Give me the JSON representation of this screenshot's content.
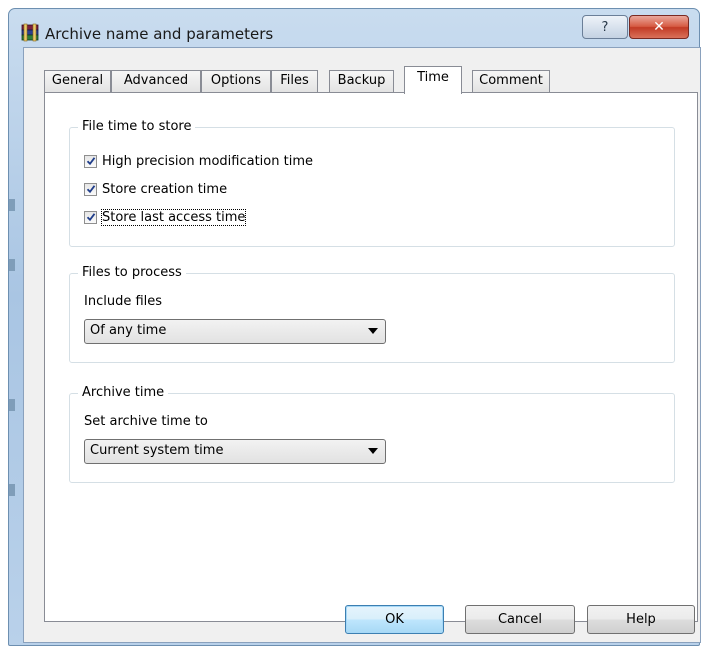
{
  "window": {
    "title": "Archive name and parameters",
    "help_glyph": "?",
    "close_glyph": "✕"
  },
  "tabs": [
    {
      "label": "General",
      "selected": false
    },
    {
      "label": "Advanced",
      "selected": false
    },
    {
      "label": "Options",
      "selected": false
    },
    {
      "label": "Files",
      "selected": false
    },
    {
      "label": "Backup",
      "selected": false
    },
    {
      "label": "Time",
      "selected": true
    },
    {
      "label": "Comment",
      "selected": false
    }
  ],
  "file_time": {
    "group_label": "File time to store",
    "options": [
      {
        "label": "High precision modification time",
        "checked": true
      },
      {
        "label": "Store creation time",
        "checked": true
      },
      {
        "label": "Store last access time",
        "checked": true,
        "focused": true
      }
    ]
  },
  "files_to_process": {
    "group_label": "Files to process",
    "field_label": "Include files",
    "selected_value": "Of any time"
  },
  "archive_time": {
    "group_label": "Archive time",
    "field_label": "Set archive time to",
    "selected_value": "Current system time"
  },
  "buttons": {
    "ok": "OK",
    "cancel": "Cancel",
    "help": "Help"
  },
  "icons": {
    "app": "winrar-books-icon",
    "help": "question-mark-icon",
    "close": "close-icon",
    "checkmark": "checkmark-icon",
    "dropdown": "chevron-down-icon"
  }
}
